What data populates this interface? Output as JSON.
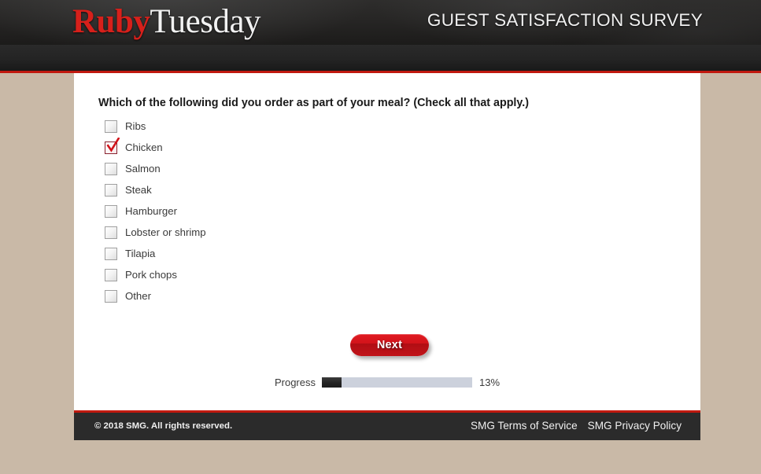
{
  "header": {
    "logo_primary": "Ruby",
    "logo_secondary": "Tuesday",
    "survey_title": "GUEST SATISFACTION SURVEY",
    "accent_red": "#c1190f",
    "background": "#1f1f1f"
  },
  "page": {
    "background_color": "#c9b9a7",
    "panel_color": "#ffffff"
  },
  "survey": {
    "question": "Which of the following did you order as part of your meal? (Check all that apply.)",
    "options": [
      {
        "label": "Ribs",
        "checked": false
      },
      {
        "label": "Chicken",
        "checked": true
      },
      {
        "label": "Salmon",
        "checked": false
      },
      {
        "label": "Steak",
        "checked": false
      },
      {
        "label": "Hamburger",
        "checked": false
      },
      {
        "label": "Lobster or shrimp",
        "checked": false
      },
      {
        "label": "Tilapia",
        "checked": false
      },
      {
        "label": "Pork chops",
        "checked": false
      },
      {
        "label": "Other",
        "checked": false
      }
    ],
    "next_label": "Next",
    "next_color": "#d2131a"
  },
  "progress": {
    "label": "Progress",
    "percent_text": "13%",
    "percent_value": 13,
    "fill_color": "#232323",
    "track_color": "#ccd1dc"
  },
  "footer": {
    "copyright": "© 2018 SMG. All rights reserved.",
    "links": [
      {
        "label": "SMG Terms of Service"
      },
      {
        "label": "SMG Privacy Policy"
      }
    ],
    "background": "#2b2b2b"
  }
}
